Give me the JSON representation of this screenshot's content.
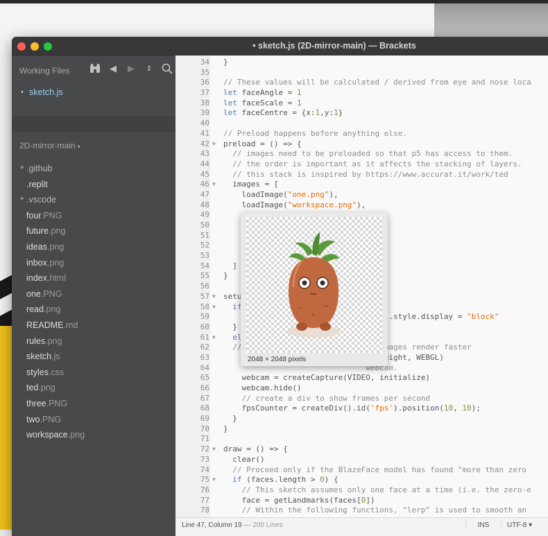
{
  "window": {
    "title": "• sketch.js (2D-mirror-main) — Brackets"
  },
  "sidebar": {
    "working_files_label": "Working Files",
    "working_file": "sketch.js",
    "project_name": "2D-mirror-main",
    "tree": [
      {
        "base": ".github",
        "ext": "",
        "folder": true
      },
      {
        "base": ".replit",
        "ext": "",
        "folder": false
      },
      {
        "base": ".vscode",
        "ext": "",
        "folder": true
      },
      {
        "base": "four",
        "ext": ".PNG",
        "folder": false
      },
      {
        "base": "future",
        "ext": ".png",
        "folder": false
      },
      {
        "base": "ideas",
        "ext": ".png",
        "folder": false
      },
      {
        "base": "inbox",
        "ext": ".png",
        "folder": false
      },
      {
        "base": "index",
        "ext": ".html",
        "folder": false
      },
      {
        "base": "one",
        "ext": ".PNG",
        "folder": false
      },
      {
        "base": "read",
        "ext": ".png",
        "folder": false
      },
      {
        "base": "README",
        "ext": ".md",
        "folder": false
      },
      {
        "base": "rules",
        "ext": ".png",
        "folder": false
      },
      {
        "base": "sketch",
        "ext": ".js",
        "folder": false
      },
      {
        "base": "styles",
        "ext": ".css",
        "folder": false
      },
      {
        "base": "ted",
        "ext": ".png",
        "folder": false
      },
      {
        "base": "three",
        "ext": ".PNG",
        "folder": false
      },
      {
        "base": "two",
        "ext": ".PNG",
        "folder": false
      },
      {
        "base": "workspace",
        "ext": ".png",
        "folder": false
      }
    ]
  },
  "editor": {
    "lines": [
      {
        "n": "34",
        "fold": false,
        "tokens": [
          [
            "d",
            "}"
          ]
        ]
      },
      {
        "n": "35",
        "fold": false,
        "tokens": []
      },
      {
        "n": "36",
        "fold": false,
        "tokens": [
          [
            "c",
            "// These values will be calculated / derived from eye and nose loca"
          ]
        ]
      },
      {
        "n": "37",
        "fold": false,
        "tokens": [
          [
            "k",
            "let "
          ],
          [
            "d",
            "faceAngle = "
          ],
          [
            "n",
            "1"
          ]
        ]
      },
      {
        "n": "38",
        "fold": false,
        "tokens": [
          [
            "k",
            "let "
          ],
          [
            "d",
            "faceScale = "
          ],
          [
            "n",
            "1"
          ]
        ]
      },
      {
        "n": "39",
        "fold": false,
        "tokens": [
          [
            "k",
            "let "
          ],
          [
            "d",
            "faceCentre = {x:"
          ],
          [
            "n",
            "1"
          ],
          [
            "d",
            ",y:"
          ],
          [
            "n",
            "1"
          ],
          [
            "d",
            "}"
          ]
        ]
      },
      {
        "n": "40",
        "fold": false,
        "tokens": []
      },
      {
        "n": "41",
        "fold": false,
        "tokens": [
          [
            "c",
            "// Preload happens before anything else."
          ]
        ]
      },
      {
        "n": "42",
        "fold": true,
        "tokens": [
          [
            "d",
            "preload = () => {"
          ]
        ]
      },
      {
        "n": "43",
        "fold": false,
        "tokens": [
          [
            "c",
            "  // images need to be preloaded so that p5 has access to them."
          ]
        ]
      },
      {
        "n": "44",
        "fold": false,
        "tokens": [
          [
            "c",
            "  // the order is important as it affects the stacking of layers."
          ]
        ]
      },
      {
        "n": "45",
        "fold": false,
        "tokens": [
          [
            "c",
            "  // this stack is inspired by https://www.accurat.it/work/ted"
          ]
        ]
      },
      {
        "n": "46",
        "fold": true,
        "tokens": [
          [
            "d",
            "  images = ["
          ]
        ]
      },
      {
        "n": "47",
        "fold": false,
        "tokens": [
          [
            "d",
            "    loadImage("
          ],
          [
            "s",
            "\"one.png\""
          ],
          [
            "d",
            "),"
          ]
        ]
      },
      {
        "n": "48",
        "fold": false,
        "tokens": [
          [
            "d",
            "    loadImage("
          ],
          [
            "s",
            "\"workspace.png\""
          ],
          [
            "d",
            "),"
          ]
        ]
      },
      {
        "n": "49",
        "fold": false,
        "tokens": []
      },
      {
        "n": "50",
        "fold": false,
        "tokens": []
      },
      {
        "n": "51",
        "fold": false,
        "tokens": []
      },
      {
        "n": "52",
        "fold": false,
        "tokens": []
      },
      {
        "n": "53",
        "fold": false,
        "tokens": []
      },
      {
        "n": "54",
        "fold": false,
        "tokens": [
          [
            "d",
            "  ]"
          ]
        ]
      },
      {
        "n": "55",
        "fold": false,
        "tokens": [
          [
            "d",
            "}"
          ]
        ]
      },
      {
        "n": "56",
        "fold": false,
        "tokens": []
      },
      {
        "n": "57",
        "fold": true,
        "tokens": [
          [
            "d",
            "setu"
          ]
        ]
      },
      {
        "n": "58",
        "fold": true,
        "tokens": [
          [
            "d",
            "  "
          ],
          [
            "k",
            "if"
          ]
        ]
      },
      {
        "n": "59",
        "fold": false,
        "tokens": [
          [
            "d",
            "                              "
          ],
          [
            "s",
            "tice'"
          ],
          [
            "d",
            ").style.display = "
          ],
          [
            "s",
            "\"block\""
          ]
        ]
      },
      {
        "n": "60",
        "fold": false,
        "tokens": [
          [
            "d",
            "  }"
          ]
        ]
      },
      {
        "n": "61",
        "fold": true,
        "tokens": [
          [
            "d",
            "  "
          ],
          [
            "k",
            "el"
          ]
        ]
      },
      {
        "n": "62",
        "fold": false,
        "tokens": [
          [
            "c",
            "  //                            r images render faster"
          ]
        ]
      },
      {
        "n": "63",
        "fold": false,
        "tokens": [
          [
            "d",
            "                               dowHeight, WEBGL)"
          ]
        ]
      },
      {
        "n": "64",
        "fold": false,
        "tokens": [
          [
            "c",
            "                               webcam."
          ]
        ]
      },
      {
        "n": "65",
        "fold": false,
        "tokens": [
          [
            "d",
            "    webcam = createCapture(VIDEO, initialize)"
          ]
        ]
      },
      {
        "n": "66",
        "fold": false,
        "tokens": [
          [
            "d",
            "    webcam.hide()"
          ]
        ]
      },
      {
        "n": "67",
        "fold": false,
        "tokens": [
          [
            "c",
            "    // create a div to show frames per second"
          ]
        ]
      },
      {
        "n": "68",
        "fold": false,
        "tokens": [
          [
            "d",
            "    fpsCounter = createDiv().id("
          ],
          [
            "s",
            "'fps'"
          ],
          [
            "d",
            ").position("
          ],
          [
            "n",
            "10"
          ],
          [
            "d",
            ", "
          ],
          [
            "n",
            "10"
          ],
          [
            "d",
            ");"
          ]
        ]
      },
      {
        "n": "69",
        "fold": false,
        "tokens": [
          [
            "d",
            "  }"
          ]
        ]
      },
      {
        "n": "70",
        "fold": false,
        "tokens": [
          [
            "d",
            "}"
          ]
        ]
      },
      {
        "n": "71",
        "fold": false,
        "tokens": []
      },
      {
        "n": "72",
        "fold": true,
        "tokens": [
          [
            "d",
            "draw = () => {"
          ]
        ]
      },
      {
        "n": "73",
        "fold": false,
        "tokens": [
          [
            "d",
            "  clear()"
          ]
        ]
      },
      {
        "n": "74",
        "fold": false,
        "tokens": [
          [
            "c",
            "  // Proceed only if the BlazeFace model has found \"more than zero"
          ]
        ]
      },
      {
        "n": "75",
        "fold": true,
        "tokens": [
          [
            "d",
            "  "
          ],
          [
            "k",
            "if "
          ],
          [
            "d",
            "(faces.length > "
          ],
          [
            "n",
            "0"
          ],
          [
            "d",
            ") {"
          ]
        ]
      },
      {
        "n": "76",
        "fold": false,
        "tokens": [
          [
            "c",
            "    // This sketch assumes only one face at a time (i.e. the zero-e"
          ]
        ]
      },
      {
        "n": "77",
        "fold": false,
        "tokens": [
          [
            "d",
            "    face = getLandmarks(faces["
          ],
          [
            "n",
            "0"
          ],
          [
            "d",
            "])"
          ]
        ]
      },
      {
        "n": "78",
        "fold": false,
        "tokens": [
          [
            "c",
            "    // Within the following functions, \"lerp\" is used to smooth an"
          ]
        ]
      }
    ]
  },
  "preview": {
    "caption": "2048 × 2048 pixels"
  },
  "statusbar": {
    "position": "Line 47, Column 19",
    "lines": " — 200 Lines",
    "mode": "INS",
    "encoding": "UTF-8 ▾"
  },
  "icons": {
    "binoculars": "binoculars-icon",
    "back": "back-arrow-icon",
    "forward": "forward-arrow-icon",
    "split": "split-view-icon",
    "search": "search-icon"
  },
  "colors": {
    "sidebar_bg": "#47494b",
    "accent_file": "#9cd1f3",
    "string": "#e46a00",
    "keyword": "#4f7bb3",
    "number": "#6f9a3a",
    "comment": "#8e8e8e"
  }
}
